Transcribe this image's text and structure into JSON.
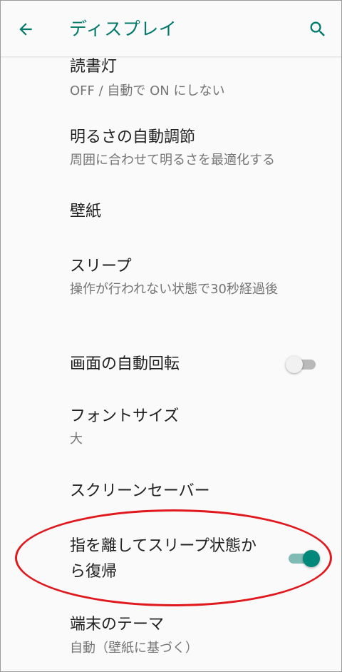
{
  "appbar": {
    "title": "ディスプレイ",
    "back_icon": "arrow-left-icon",
    "search_icon": "search-icon",
    "accent_color": "#00796b"
  },
  "settings": [
    {
      "title": "読書灯",
      "summary": "OFF / 自動で ON にしない"
    },
    {
      "title": "明るさの自動調節",
      "summary": "周囲に合わせて明るさを最適化する"
    },
    {
      "title": "壁紙"
    },
    {
      "title": "スリープ",
      "summary": "操作が行われない状態で30秒経過後"
    },
    {
      "title": "画面の自動回転",
      "switch_state": "off"
    },
    {
      "title": "フォントサイズ",
      "summary": "大"
    },
    {
      "title": "スクリーンセーバー"
    },
    {
      "title": "指を離してスリープ状態から復帰",
      "switch_state": "on"
    },
    {
      "title": "端末のテーマ",
      "summary": "自動（壁紙に基づく）"
    }
  ],
  "annotation": {
    "shape": "ellipse",
    "color": "#e0191e"
  }
}
